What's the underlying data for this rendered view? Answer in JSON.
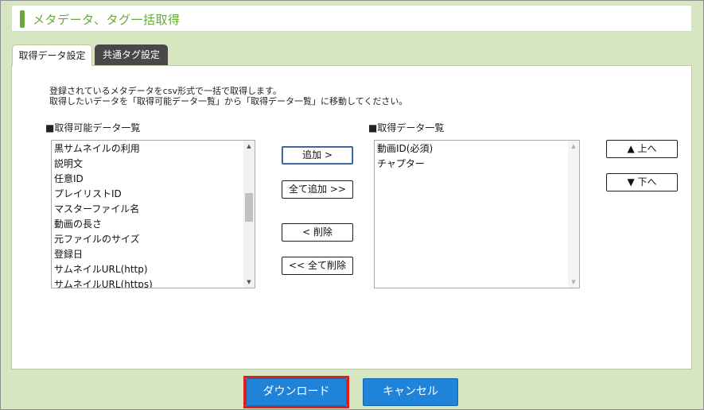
{
  "dialog": {
    "title": "メタデータ、タグ一括取得"
  },
  "tabs": [
    {
      "label": "取得データ設定",
      "active": true
    },
    {
      "label": "共通タグ設定",
      "active": false
    }
  ],
  "description": {
    "line1": "登録されているメタデータをcsv形式で一括で取得します。",
    "line2": "取得したいデータを「取得可能データ一覧」から「取得データ一覧」に移動してください。"
  },
  "available_list": {
    "heading": "■取得可能データ一覧",
    "items": [
      "黒サムネイルの利用",
      "説明文",
      "任意ID",
      "プレイリストID",
      "マスターファイル名",
      "動画の長さ",
      "元ファイルのサイズ",
      "登録日",
      "サムネイルURL(http)",
      "サムネイルURL(https)"
    ],
    "scroll_position_fraction": 0.42
  },
  "selected_list": {
    "heading": "■取得データ一覧",
    "items": [
      "動画ID(必須)",
      "チャプター"
    ]
  },
  "move_buttons": {
    "add": "追加 >",
    "add_all": "全て追加 >>",
    "remove": "< 削除",
    "remove_all": "<< 全て削除"
  },
  "order_buttons": {
    "up": "▲ 上へ",
    "down": "▼ 下へ"
  },
  "footer": {
    "download": "ダウンロード",
    "cancel": "キャンセル"
  },
  "icons": {
    "scroll_up": "▲",
    "scroll_down": "▼"
  },
  "colors": {
    "background": "#d5e6c1",
    "accent_green": "#6aa83a",
    "primary_button": "#1f83d9",
    "highlight_outline": "#e21b1b",
    "inactive_tab": "#484848"
  }
}
